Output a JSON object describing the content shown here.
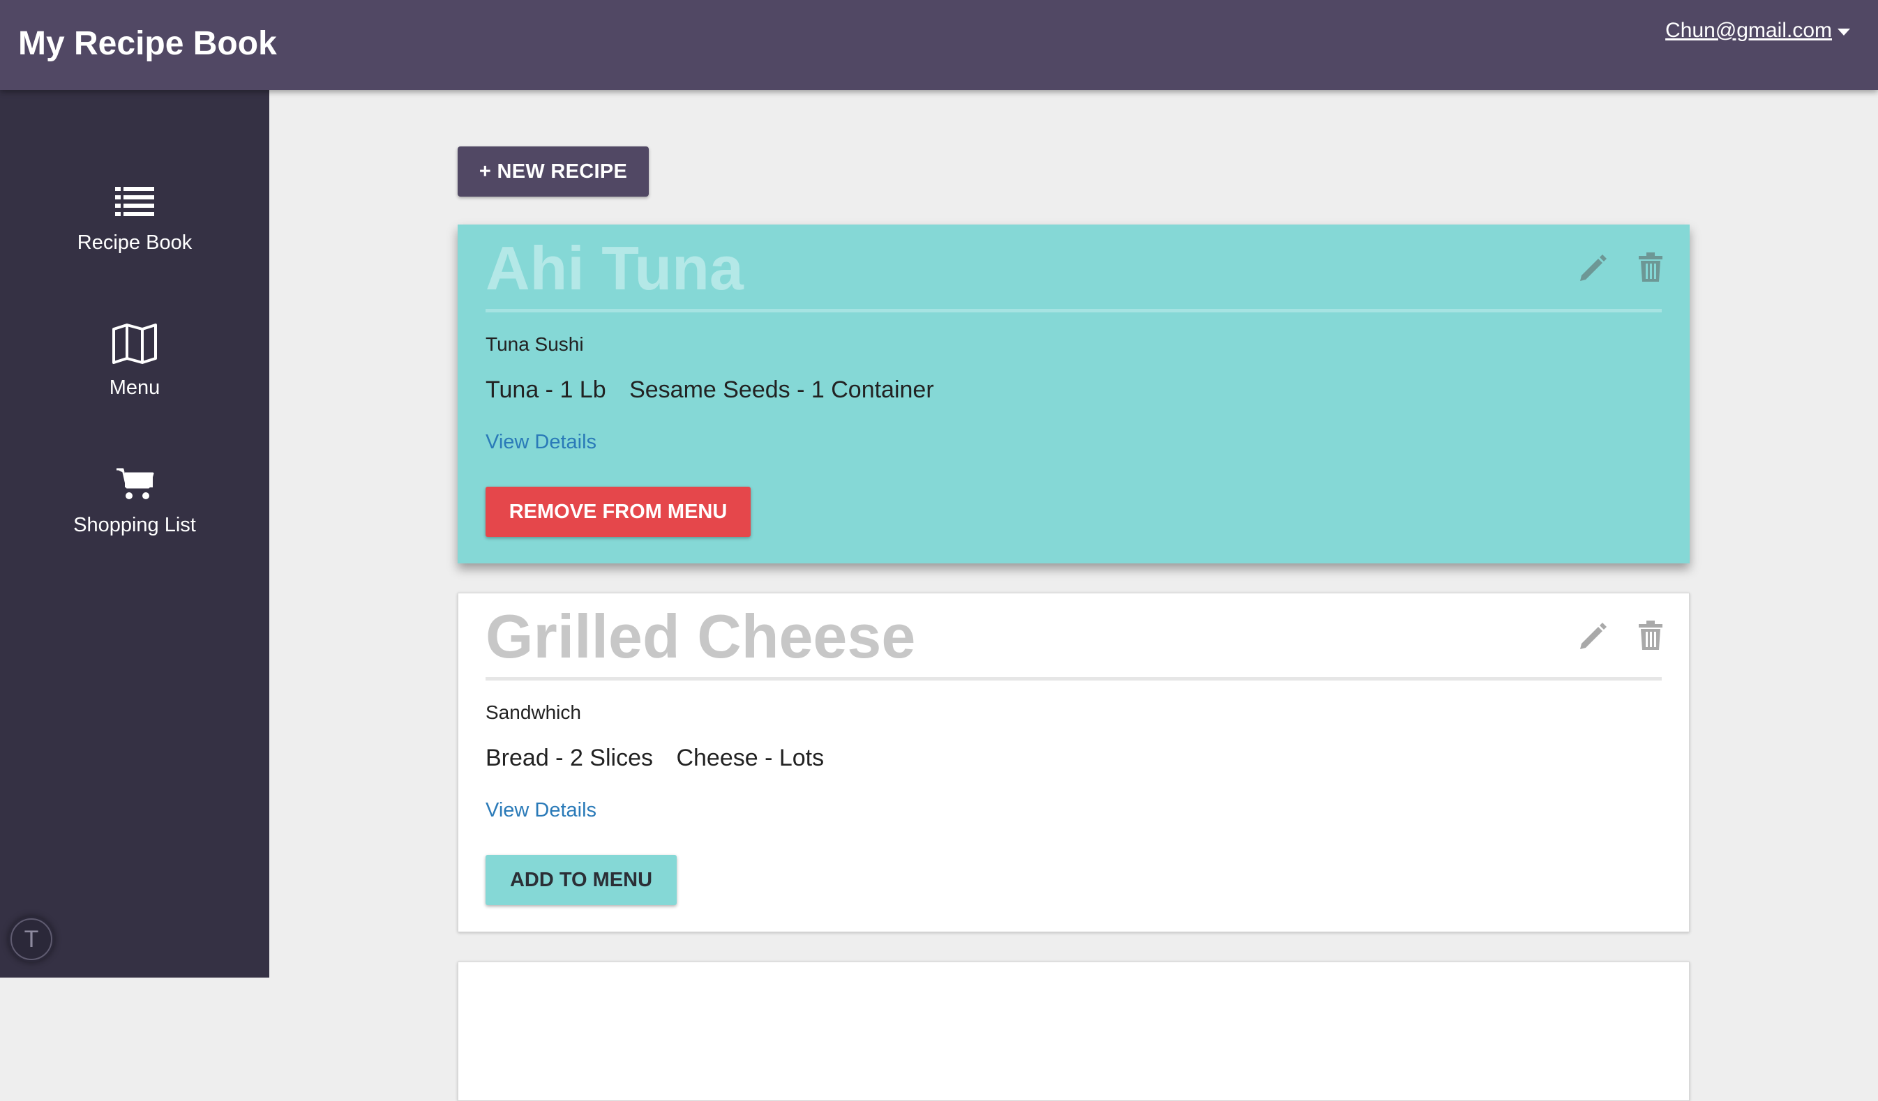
{
  "header": {
    "title": "My Recipe Book",
    "user_email": "Chun@gmail.com",
    "background": "#514864"
  },
  "sidebar": {
    "background": "#353144",
    "items": [
      {
        "label": "Recipe Book",
        "icon": "list-icon"
      },
      {
        "label": "Menu",
        "icon": "map-icon"
      },
      {
        "label": "Shopping List",
        "icon": "cart-icon"
      }
    ],
    "avatar_initial": "T"
  },
  "main": {
    "new_recipe_label": "+ NEW RECIPE",
    "recipes": [
      {
        "title": "Ahi Tuna",
        "description": "Tuna Sushi",
        "ingredients": [
          "Tuna - 1 Lb",
          "Sesame Seeds - 1 Container"
        ],
        "view_details_label": "View Details",
        "menu_action_label": "REMOVE FROM MENU",
        "on_menu": true,
        "background": "#85d8d6"
      },
      {
        "title": "Grilled Cheese",
        "description": "Sandwhich",
        "ingredients": [
          "Bread - 2 Slices",
          "Cheese - Lots"
        ],
        "view_details_label": "View Details",
        "menu_action_label": "ADD TO MENU",
        "on_menu": false,
        "background": "#ffffff"
      }
    ]
  },
  "colors": {
    "accent_teal": "#85d8d6",
    "danger_red": "#e5474b",
    "link_blue": "#2a7ab8"
  }
}
